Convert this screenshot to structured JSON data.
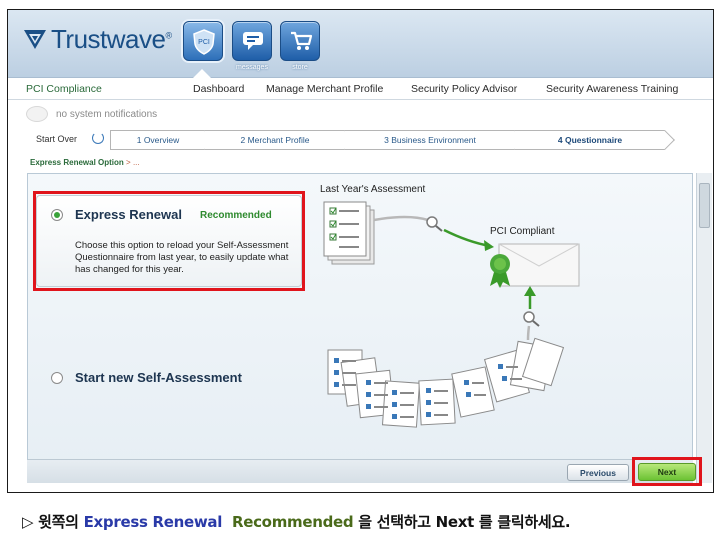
{
  "header": {
    "logo_text": "Trustwave",
    "toolbar": [
      {
        "name": "pci-tab",
        "label": "PCI",
        "caption": ""
      },
      {
        "name": "messages-tab",
        "label": "",
        "caption": "messages"
      },
      {
        "name": "store-tab",
        "label": "",
        "caption": "store"
      }
    ]
  },
  "nav": {
    "section": "PCI Compliance",
    "items": [
      "Dashboard",
      "Manage Merchant Profile",
      "Security Policy Advisor",
      "Security Awareness Training"
    ]
  },
  "notifications": {
    "text": "no system notifications"
  },
  "steps": {
    "start_over": "Start Over",
    "items": [
      "1 Overview",
      "2 Merchant Profile",
      "3 Business Environment",
      "4 Questionnaire"
    ],
    "current_index": 3
  },
  "breadcrumb": {
    "current": "Express Renewal Option",
    "rest": "> ..."
  },
  "options": {
    "express": {
      "title": "Express Renewal",
      "badge": "Recommended",
      "description": "Choose this option to reload your Self-Assessment Questionnaire from last year, to easily update what has changed for this year.",
      "selected": true
    },
    "new": {
      "title": "Start new Self-Assessment",
      "selected": false
    }
  },
  "diagram": {
    "last_year_label": "Last Year's Assessment",
    "compliant_label": "PCI Compliant"
  },
  "buttons": {
    "previous": "Previous",
    "next": "Next"
  },
  "instruction": {
    "prefix": "▷ 윗쪽의 ",
    "blue": "Express Renewal",
    "green": "Recommended",
    "suffix": " 을 선택하고 Next 를 클릭하세요."
  },
  "colors": {
    "brand_blue": "#1a4f86",
    "accent_green": "#2e8a2e",
    "highlight_red": "#e0141c"
  }
}
